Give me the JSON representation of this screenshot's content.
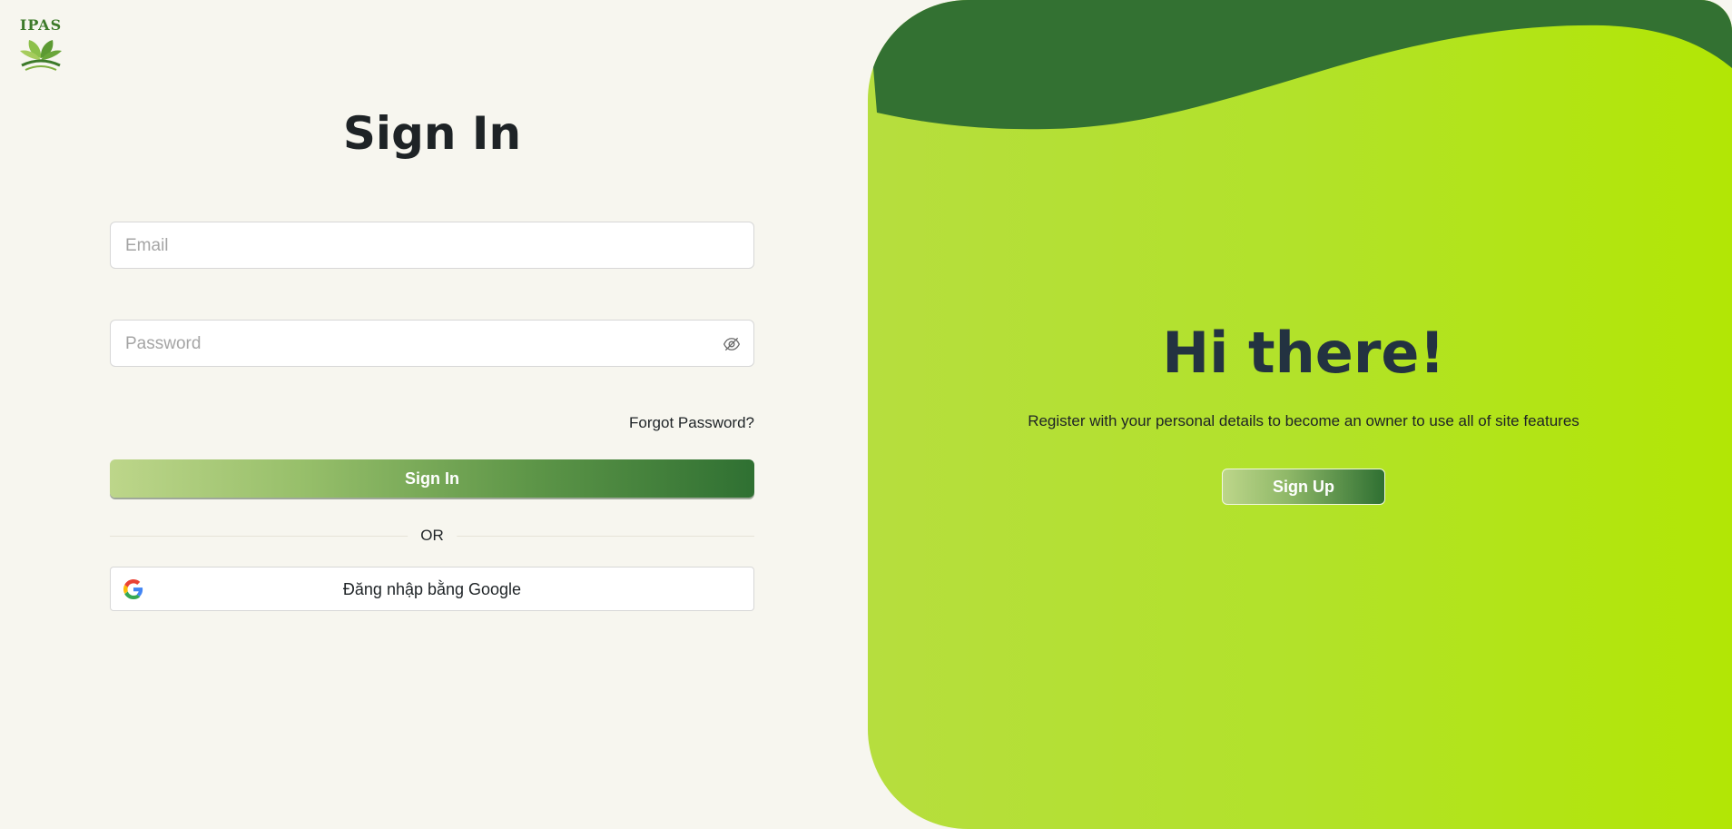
{
  "logo": {
    "text": "IPAS"
  },
  "signin": {
    "title": "Sign In",
    "email_placeholder": "Email",
    "password_placeholder": "Password",
    "forgot_label": "Forgot Password?",
    "button_label": "Sign In",
    "divider_label": "OR",
    "google_label": "Đăng nhập bằng Google"
  },
  "welcome": {
    "title": "Hi there!",
    "subtitle": "Register with your personal details to become an owner to use all of site features",
    "signup_label": "Sign Up"
  },
  "icons": {
    "eye": "eye-off-icon",
    "google": "google-icon",
    "logo": "leaf-logo-icon"
  },
  "colors": {
    "background": "#f7f6ef",
    "accent_dark": "#2f7032",
    "accent_lime": "#b2e605",
    "wave": "#337132"
  }
}
